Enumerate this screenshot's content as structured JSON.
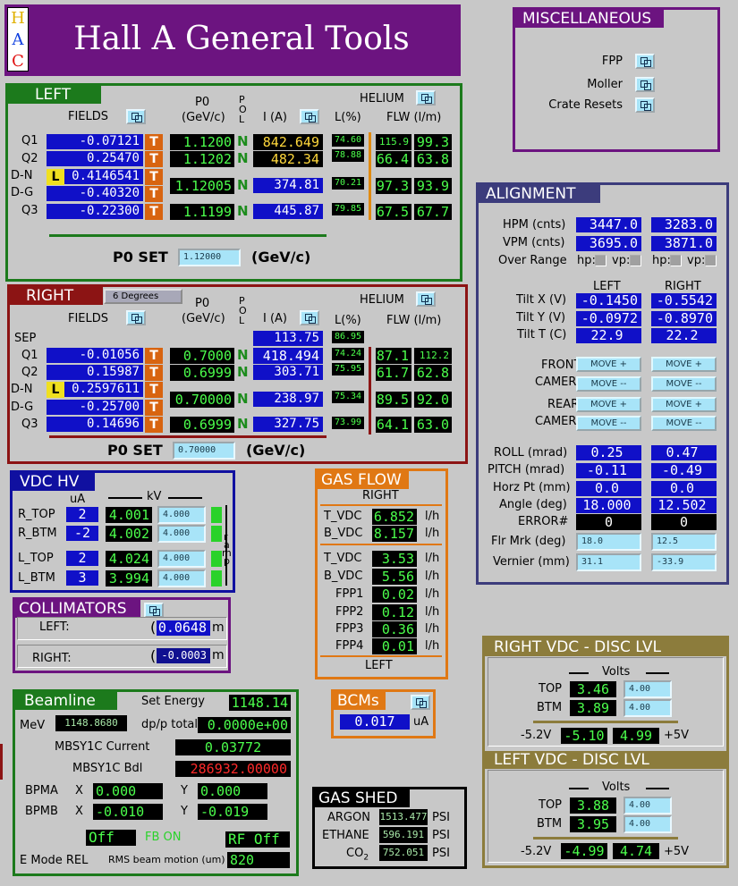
{
  "header": {
    "h": "H",
    "a": "A",
    "c": "C",
    "title": "Hall A General Tools"
  },
  "misc": {
    "title": "MISCELLANEOUS",
    "items": [
      "FPP",
      "Moller",
      "Crate Resets"
    ]
  },
  "left": {
    "title": "LEFT",
    "fields": "FIELDS",
    "p0": "P0",
    "p0unit": "(GeV/c)",
    "pol": [
      "P",
      "O",
      "L"
    ],
    "current": "I (A)",
    "helium": "HELIUM",
    "level": "L(%)",
    "flow": "FLW (l/m)",
    "rows": [
      {
        "name": "Q1",
        "field": "-0.07121",
        "tag": "",
        "p0": "1.1200",
        "n": "N",
        "i": "842.649",
        "l": "74.60",
        "f1": "115.9",
        "f2": "99.3"
      },
      {
        "name": "Q2",
        "field": "0.25470",
        "tag": "",
        "p0": "1.1202",
        "n": "N",
        "i": "482.34",
        "l": "78.88",
        "f1": "66.4",
        "f2": "63.8"
      },
      {
        "name": "D-N",
        "field": "0.4146541",
        "tag": "L",
        "p0": "1.12005",
        "n": "N",
        "i": "374.81",
        "l": "70.21",
        "f1": "97.3",
        "f2": "93.9"
      },
      {
        "name": "D-G",
        "field": "-0.40320",
        "tag": ""
      },
      {
        "name": "Q3",
        "field": "-0.22300",
        "tag": "",
        "p0": "1.1199",
        "n": "N",
        "i": "445.87",
        "l": "79.85",
        "f1": "67.5",
        "f2": "67.7"
      }
    ],
    "t": "T",
    "p0set": "P0 SET",
    "p0set_val": "1.12000",
    "p0set_unit": "(GeV/c)"
  },
  "right": {
    "title": "RIGHT",
    "menu": "6 Degrees",
    "fields": "FIELDS",
    "p0": "P0",
    "p0unit": "(GeV/c)",
    "pol": [
      "P",
      "O",
      "L"
    ],
    "current": "I (A)",
    "helium": "HELIUM",
    "level": "L(%)",
    "flow": "FLW (l/m)",
    "sep": {
      "name": "SEP",
      "i": "113.75",
      "l": "86.95"
    },
    "rows": [
      {
        "name": "Q1",
        "field": "-0.01056",
        "tag": "",
        "p0": "0.7000",
        "n": "N",
        "i": "418.494",
        "l": "74.24",
        "f1": "87.1",
        "f2": "112.2"
      },
      {
        "name": "Q2",
        "field": "0.15987",
        "tag": "",
        "p0": "0.6999",
        "n": "N",
        "i": "303.71",
        "l": "75.95",
        "f1": "61.7",
        "f2": "62.8"
      },
      {
        "name": "D-N",
        "field": "0.2597611",
        "tag": "L",
        "p0": "0.70000",
        "n": "N",
        "i": "238.97",
        "l": "75.34",
        "f1": "89.5",
        "f2": "92.0"
      },
      {
        "name": "D-G",
        "field": "-0.25700",
        "tag": ""
      },
      {
        "name": "Q3",
        "field": "0.14696",
        "tag": "",
        "p0": "0.6999",
        "n": "N",
        "i": "327.75",
        "l": "73.99",
        "f1": "64.1",
        "f2": "63.0"
      }
    ],
    "t": "T",
    "p0set": "P0 SET",
    "p0set_val": "0.70000",
    "p0set_unit": "(GeV/c)"
  },
  "alignment": {
    "title": "ALIGNMENT",
    "hpm": {
      "label": "HPM (cnts)",
      "l": "3447.0",
      "r": "3283.0"
    },
    "vpm": {
      "label": "VPM (cnts)",
      "l": "3695.0",
      "r": "3871.0"
    },
    "over": {
      "label": "Over Range",
      "hp": "hp:",
      "vp": "vp:"
    },
    "col_left": "LEFT",
    "col_right": "RIGHT",
    "tiltx": {
      "label": "Tilt X (V)",
      "l": "-0.1450",
      "r": "-0.5542"
    },
    "tilty": {
      "label": "Tilt Y (V)",
      "l": "-0.0972",
      "r": "-0.8970"
    },
    "tiltt": {
      "label": "Tilt T (C)",
      "l": "22.9",
      "r": "22.2"
    },
    "front": "FRONT",
    "rear": "REAR",
    "camera": "CAMERA",
    "move_plus": "MOVE +",
    "move_minus": "MOVE --",
    "roll": {
      "label": "ROLL (mrad)",
      "l": "0.25",
      "r": "0.47"
    },
    "pitch": {
      "label": "PITCH (mrad)",
      "l": "-0.11",
      "r": "-0.49"
    },
    "horz": {
      "label": "Horz Pt (mm)",
      "l": "0.0",
      "r": "0.0"
    },
    "angle": {
      "label": "Angle (deg)",
      "l": "18.000",
      "r": "12.502"
    },
    "error": {
      "label": "ERROR#",
      "l": "0",
      "r": "0"
    },
    "flr": {
      "label": "Flr Mrk (deg)",
      "l": "18.0",
      "r": "12.5"
    },
    "vernier": {
      "label": "Vernier (mm)",
      "l": "31.1",
      "r": "-33.9"
    }
  },
  "vdchv": {
    "title": "VDC HV",
    "ua": "uA",
    "kv": "kV",
    "ramp": [
      "r",
      "a",
      "m",
      "p"
    ],
    "rows": [
      {
        "name": "R_TOP",
        "ua": "2",
        "kv": "4.001",
        "set": "4.000"
      },
      {
        "name": "R_BTM",
        "ua": "-2",
        "kv": "4.002",
        "set": "4.000"
      },
      {
        "name": "L_TOP",
        "ua": "2",
        "kv": "4.024",
        "set": "4.000"
      },
      {
        "name": "L_BTM",
        "ua": "3",
        "kv": "3.994",
        "set": "4.000"
      }
    ]
  },
  "gasflow": {
    "title": "GAS FLOW",
    "right": "RIGHT",
    "left": "LEFT",
    "unit": "l/h",
    "rrows": [
      {
        "name": "T_VDC",
        "v": "6.852"
      },
      {
        "name": "B_VDC",
        "v": "8.157"
      }
    ],
    "lrows": [
      {
        "name": "T_VDC",
        "v": "3.53"
      },
      {
        "name": "B_VDC",
        "v": "5.56"
      },
      {
        "name": "FPP1",
        "v": "0.02"
      },
      {
        "name": "FPP2",
        "v": "0.12"
      },
      {
        "name": "FPP3",
        "v": "0.36"
      },
      {
        "name": "FPP4",
        "v": "0.01"
      }
    ]
  },
  "collimators": {
    "title": "COLLIMATORS",
    "left_label": "LEFT:",
    "left_val": "0.0648",
    "right_label": "RIGHT:",
    "right_val": "-0.0003",
    "unit": "m",
    "paren": "("
  },
  "beamline": {
    "title": "Beamline",
    "set_energy": "Set Energy",
    "set_energy_val": "1148.14",
    "mev": "MeV",
    "mev_val": "1148.8680",
    "dpp": "dp/p total",
    "dpp_val": "0.0000e+00",
    "mbsy_cur": "MBSY1C Current",
    "mbsy_cur_val": "0.03772",
    "mbsy_bdl": "MBSY1C Bdl",
    "mbsy_bdl_val": "286932.00000",
    "bpma": "BPMA",
    "bpmb": "BPMB",
    "x": "X",
    "y": "Y",
    "bpma_x": "0.000",
    "bpma_y": "0.000",
    "bpmb_x": "-0.010",
    "bpmb_y": "-0.019",
    "off": "Off",
    "fb_on": "FB ON",
    "rf_off": "RF Off",
    "emode": "E Mode REL",
    "rms": "RMS beam motion (um)",
    "rms_val": "820"
  },
  "bcms": {
    "title": "BCMs",
    "val": "0.017",
    "unit": "uA"
  },
  "gasshed": {
    "title": "GAS SHED",
    "rows": [
      {
        "name": "ARGON",
        "v": "1513.477",
        "u": "PSI"
      },
      {
        "name": "ETHANE",
        "v": "596.191",
        "u": "PSI"
      },
      {
        "name": "CO",
        "sub": "2",
        "v": "752.051",
        "u": "PSI"
      }
    ]
  },
  "rvdc": {
    "title": "RIGHT VDC - DISC LVL",
    "volts": "Volts",
    "top": "TOP",
    "btm": "BTM",
    "top_v": "3.46",
    "top_set": "4.00",
    "btm_v": "3.89",
    "btm_set": "4.00",
    "neg": "-5.2V",
    "neg_v": "-5.10",
    "pos_v": "4.99",
    "pos": "+5V"
  },
  "lvdc": {
    "title": "LEFT VDC - DISC LVL",
    "volts": "Volts",
    "top": "TOP",
    "btm": "BTM",
    "top_v": "3.88",
    "top_set": "4.00",
    "btm_v": "3.95",
    "btm_set": "4.00",
    "neg": "-5.2V",
    "neg_v": "-4.99",
    "pos_v": "4.74",
    "pos": "+5V"
  },
  "colors": {
    "purple": "#6c1480",
    "green": "#1c7a1c",
    "maroon": "#8c1414",
    "navy": "#1010a0",
    "olive": "#8c7c3c",
    "orange": "#e07814",
    "dark_blue": "#3c3c7c"
  }
}
